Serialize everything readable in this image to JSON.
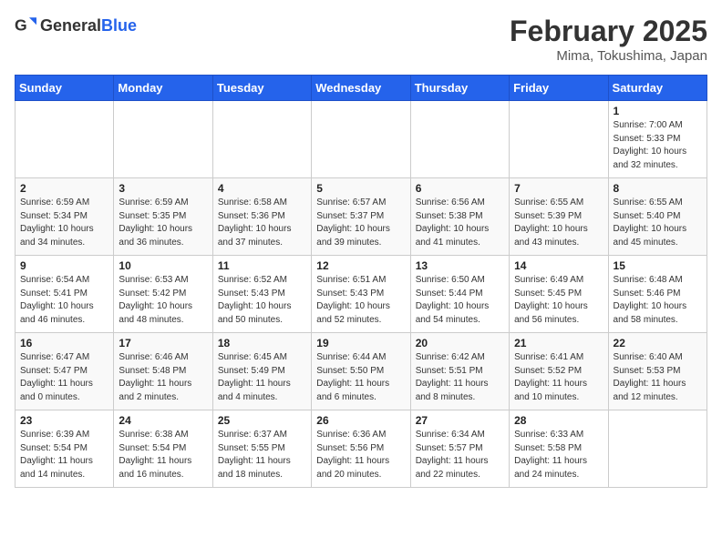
{
  "header": {
    "logo_general": "General",
    "logo_blue": "Blue",
    "month_year": "February 2025",
    "location": "Mima, Tokushima, Japan"
  },
  "days_of_week": [
    "Sunday",
    "Monday",
    "Tuesday",
    "Wednesday",
    "Thursday",
    "Friday",
    "Saturday"
  ],
  "weeks": [
    [
      {
        "day": "",
        "content": ""
      },
      {
        "day": "",
        "content": ""
      },
      {
        "day": "",
        "content": ""
      },
      {
        "day": "",
        "content": ""
      },
      {
        "day": "",
        "content": ""
      },
      {
        "day": "",
        "content": ""
      },
      {
        "day": "1",
        "content": "Sunrise: 7:00 AM\nSunset: 5:33 PM\nDaylight: 10 hours\nand 32 minutes."
      }
    ],
    [
      {
        "day": "2",
        "content": "Sunrise: 6:59 AM\nSunset: 5:34 PM\nDaylight: 10 hours\nand 34 minutes."
      },
      {
        "day": "3",
        "content": "Sunrise: 6:59 AM\nSunset: 5:35 PM\nDaylight: 10 hours\nand 36 minutes."
      },
      {
        "day": "4",
        "content": "Sunrise: 6:58 AM\nSunset: 5:36 PM\nDaylight: 10 hours\nand 37 minutes."
      },
      {
        "day": "5",
        "content": "Sunrise: 6:57 AM\nSunset: 5:37 PM\nDaylight: 10 hours\nand 39 minutes."
      },
      {
        "day": "6",
        "content": "Sunrise: 6:56 AM\nSunset: 5:38 PM\nDaylight: 10 hours\nand 41 minutes."
      },
      {
        "day": "7",
        "content": "Sunrise: 6:55 AM\nSunset: 5:39 PM\nDaylight: 10 hours\nand 43 minutes."
      },
      {
        "day": "8",
        "content": "Sunrise: 6:55 AM\nSunset: 5:40 PM\nDaylight: 10 hours\nand 45 minutes."
      }
    ],
    [
      {
        "day": "9",
        "content": "Sunrise: 6:54 AM\nSunset: 5:41 PM\nDaylight: 10 hours\nand 46 minutes."
      },
      {
        "day": "10",
        "content": "Sunrise: 6:53 AM\nSunset: 5:42 PM\nDaylight: 10 hours\nand 48 minutes."
      },
      {
        "day": "11",
        "content": "Sunrise: 6:52 AM\nSunset: 5:43 PM\nDaylight: 10 hours\nand 50 minutes."
      },
      {
        "day": "12",
        "content": "Sunrise: 6:51 AM\nSunset: 5:43 PM\nDaylight: 10 hours\nand 52 minutes."
      },
      {
        "day": "13",
        "content": "Sunrise: 6:50 AM\nSunset: 5:44 PM\nDaylight: 10 hours\nand 54 minutes."
      },
      {
        "day": "14",
        "content": "Sunrise: 6:49 AM\nSunset: 5:45 PM\nDaylight: 10 hours\nand 56 minutes."
      },
      {
        "day": "15",
        "content": "Sunrise: 6:48 AM\nSunset: 5:46 PM\nDaylight: 10 hours\nand 58 minutes."
      }
    ],
    [
      {
        "day": "16",
        "content": "Sunrise: 6:47 AM\nSunset: 5:47 PM\nDaylight: 11 hours\nand 0 minutes."
      },
      {
        "day": "17",
        "content": "Sunrise: 6:46 AM\nSunset: 5:48 PM\nDaylight: 11 hours\nand 2 minutes."
      },
      {
        "day": "18",
        "content": "Sunrise: 6:45 AM\nSunset: 5:49 PM\nDaylight: 11 hours\nand 4 minutes."
      },
      {
        "day": "19",
        "content": "Sunrise: 6:44 AM\nSunset: 5:50 PM\nDaylight: 11 hours\nand 6 minutes."
      },
      {
        "day": "20",
        "content": "Sunrise: 6:42 AM\nSunset: 5:51 PM\nDaylight: 11 hours\nand 8 minutes."
      },
      {
        "day": "21",
        "content": "Sunrise: 6:41 AM\nSunset: 5:52 PM\nDaylight: 11 hours\nand 10 minutes."
      },
      {
        "day": "22",
        "content": "Sunrise: 6:40 AM\nSunset: 5:53 PM\nDaylight: 11 hours\nand 12 minutes."
      }
    ],
    [
      {
        "day": "23",
        "content": "Sunrise: 6:39 AM\nSunset: 5:54 PM\nDaylight: 11 hours\nand 14 minutes."
      },
      {
        "day": "24",
        "content": "Sunrise: 6:38 AM\nSunset: 5:54 PM\nDaylight: 11 hours\nand 16 minutes."
      },
      {
        "day": "25",
        "content": "Sunrise: 6:37 AM\nSunset: 5:55 PM\nDaylight: 11 hours\nand 18 minutes."
      },
      {
        "day": "26",
        "content": "Sunrise: 6:36 AM\nSunset: 5:56 PM\nDaylight: 11 hours\nand 20 minutes."
      },
      {
        "day": "27",
        "content": "Sunrise: 6:34 AM\nSunset: 5:57 PM\nDaylight: 11 hours\nand 22 minutes."
      },
      {
        "day": "28",
        "content": "Sunrise: 6:33 AM\nSunset: 5:58 PM\nDaylight: 11 hours\nand 24 minutes."
      },
      {
        "day": "",
        "content": ""
      }
    ]
  ]
}
